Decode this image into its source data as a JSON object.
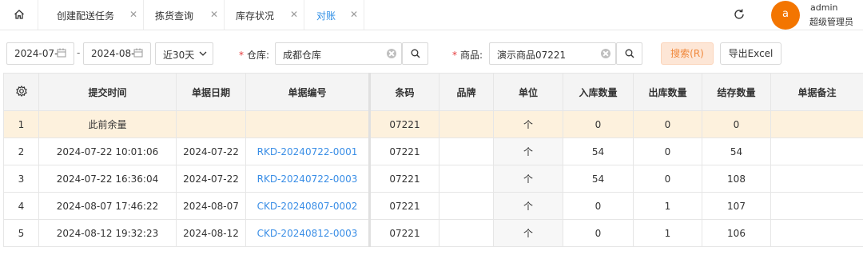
{
  "tabs": [
    {
      "label": "创建配送任务",
      "active": false
    },
    {
      "label": "拣货查询",
      "active": false
    },
    {
      "label": "库存状况",
      "active": false
    },
    {
      "label": "对账",
      "active": true
    }
  ],
  "user": {
    "avatar_letter": "a",
    "name": "admin",
    "role": "超级管理员"
  },
  "filters": {
    "date_from": "2024-07-",
    "date_to": "2024-08-",
    "range": "近30天",
    "warehouse_label": "仓库:",
    "warehouse_value": "成都仓库",
    "product_label": "商品:",
    "product_value": "演示商品07221",
    "search_button": "搜索(R)",
    "export_button": "导出Excel"
  },
  "table": {
    "columns": [
      "提交时间",
      "单据日期",
      "单据编号",
      "条码",
      "品牌",
      "单位",
      "入库数量",
      "出库数量",
      "结存数量",
      "单据备注"
    ],
    "rows": [
      [
        "1",
        "此前余量",
        "",
        "",
        "07221",
        "",
        "个",
        "0",
        "0",
        "0",
        ""
      ],
      [
        "2",
        "2024-07-22 10:01:06",
        "2024-07-22",
        "RKD-20240722-0001",
        "07221",
        "",
        "个",
        "54",
        "0",
        "54",
        ""
      ],
      [
        "3",
        "2024-07-22 16:36:04",
        "2024-07-22",
        "RKD-20240722-0003",
        "07221",
        "",
        "个",
        "54",
        "0",
        "108",
        ""
      ],
      [
        "4",
        "2024-08-07 17:46:22",
        "2024-08-07",
        "CKD-20240807-0002",
        "07221",
        "",
        "个",
        "0",
        "1",
        "107",
        ""
      ],
      [
        "5",
        "2024-08-12 19:32:23",
        "2024-08-12",
        "CKD-20240812-0003",
        "07221",
        "",
        "个",
        "0",
        "1",
        "106",
        ""
      ]
    ]
  }
}
